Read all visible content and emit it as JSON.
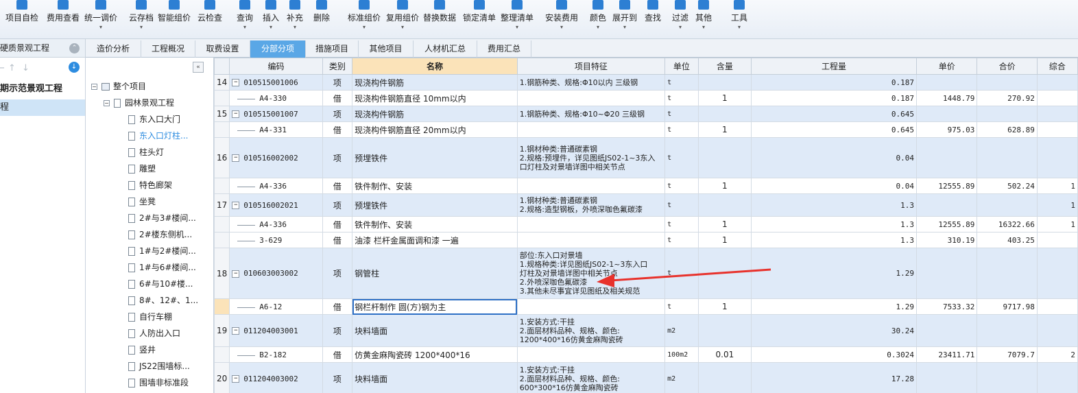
{
  "toolbar": {
    "buttons": [
      {
        "label": "项目自检",
        "icon": "check-icon",
        "dd": false
      },
      {
        "label": "费用查看",
        "icon": "view-icon",
        "dd": false
      },
      {
        "label": "统一调价",
        "icon": "adjust-icon",
        "dd": true
      },
      {
        "label": "云存档",
        "icon": "cloud-upload-icon",
        "dd": true
      },
      {
        "label": "智能组价",
        "icon": "smart-icon",
        "dd": false
      },
      {
        "label": "云检查",
        "icon": "cloud-check-icon",
        "dd": false
      },
      {
        "label": "查询",
        "icon": "search-icon",
        "dd": true
      },
      {
        "label": "插入",
        "icon": "insert-icon",
        "dd": true
      },
      {
        "label": "补充",
        "icon": "add-icon",
        "dd": true
      },
      {
        "label": "删除",
        "icon": "delete-icon",
        "dd": false
      },
      {
        "label": "标准组价",
        "icon": "standard-icon",
        "dd": true
      },
      {
        "label": "复用组价",
        "icon": "reuse-icon",
        "dd": true
      },
      {
        "label": "替换数据",
        "icon": "replace-icon",
        "dd": false
      },
      {
        "label": "锁定清单",
        "icon": "lock-icon",
        "dd": false
      },
      {
        "label": "整理清单",
        "icon": "organize-icon",
        "dd": true
      },
      {
        "label": "安装费用",
        "icon": "install-icon",
        "dd": true
      },
      {
        "label": "颜色",
        "icon": "color-icon",
        "dd": true
      },
      {
        "label": "展开到",
        "icon": "expand-icon",
        "dd": true
      },
      {
        "label": "查找",
        "icon": "find-icon",
        "dd": false
      },
      {
        "label": "过滤",
        "icon": "filter-icon",
        "dd": true
      },
      {
        "label": "其他",
        "icon": "other-icon",
        "dd": true
      },
      {
        "label": "工具",
        "icon": "tool-icon",
        "dd": true
      }
    ]
  },
  "left": {
    "header": "硬质景观工程",
    "project": "期示范景观工程",
    "selected": "程"
  },
  "tabs": [
    "造价分析",
    "工程概况",
    "取费设置",
    "分部分项",
    "措施项目",
    "其他项目",
    "人材机汇总",
    "费用汇总"
  ],
  "active_tab": "分部分项",
  "tree": {
    "root": "整个项目",
    "group": "园林景观工程",
    "items": [
      "东入口大门",
      "东入口灯柱...",
      "柱头灯",
      "雕塑",
      "特色廊架",
      "坐凳",
      "2#与3#楼间...",
      "2#楼东侧机...",
      "1#与2#楼间...",
      "1#与6#楼间...",
      "6#与10#楼...",
      "8#、12#、1...",
      "自行车棚",
      "人防出入口",
      "竖井",
      "JS22围墙标...",
      "围墙非标准段"
    ],
    "highlighted": "东入口灯柱..."
  },
  "grid": {
    "headers": [
      "",
      "编码",
      "类别",
      "名称",
      "项目特征",
      "单位",
      "含量",
      "工程量",
      "单价",
      "合价",
      "综合"
    ],
    "rows": [
      {
        "n": "14",
        "kind": "main",
        "code": "010515001006",
        "cat": "项",
        "name": "现浇构件钢筋",
        "feat": [
          "1.钢筋种类、规格:Φ10以内 三级钢"
        ],
        "unit": "t",
        "qty": "",
        "amt": "0.187",
        "price": "",
        "total": "",
        "last": "",
        "h": 23
      },
      {
        "n": "",
        "kind": "sub",
        "code": "A4-330",
        "cat": "借",
        "name": "现浇构件钢筋直径 10mm以内",
        "feat": [],
        "unit": "t",
        "qty": "1",
        "amt": "0.187",
        "price": "1448.79",
        "total": "270.92",
        "last": "",
        "h": 23
      },
      {
        "n": "15",
        "kind": "main",
        "code": "010515001007",
        "cat": "项",
        "name": "现浇构件钢筋",
        "feat": [
          "1.钢筋种类、规格:Φ10~Φ20 三级钢"
        ],
        "unit": "t",
        "qty": "",
        "amt": "0.645",
        "price": "",
        "total": "",
        "last": "",
        "h": 23
      },
      {
        "n": "",
        "kind": "sub",
        "code": "A4-331",
        "cat": "借",
        "name": "现浇构件钢筋直径 20mm以内",
        "feat": [],
        "unit": "t",
        "qty": "1",
        "amt": "0.645",
        "price": "975.03",
        "total": "628.89",
        "last": "",
        "h": 23
      },
      {
        "n": "16",
        "kind": "main",
        "code": "010516002002",
        "cat": "项",
        "name": "预埋铁件",
        "feat": [
          "1.钢材种类:普通碳素钢",
          "2.规格:预埋件，详见图纸JS02-1~3东入",
          "口灯柱及对景墙详图中相关节点"
        ],
        "unit": "t",
        "qty": "",
        "amt": "0.04",
        "price": "",
        "total": "",
        "last": "",
        "h": 59
      },
      {
        "n": "",
        "kind": "sub",
        "code": "A4-336",
        "cat": "借",
        "name": "铁件制作、安装",
        "feat": [],
        "unit": "t",
        "qty": "1",
        "amt": "0.04",
        "price": "12555.89",
        "total": "502.24",
        "last": "1",
        "h": 23
      },
      {
        "n": "17",
        "kind": "main",
        "code": "010516002021",
        "cat": "项",
        "name": "预埋铁件",
        "feat": [
          "1.钢材种类:普通碳素钢",
          "2.规格:造型钢板，外喷深咖色氟碳漆"
        ],
        "unit": "t",
        "qty": "",
        "amt": "1.3",
        "price": "",
        "total": "",
        "last": "1",
        "h": 33
      },
      {
        "n": "",
        "kind": "sub",
        "code": "A4-336",
        "cat": "借",
        "name": "铁件制作、安装",
        "feat": [],
        "unit": "t",
        "qty": "1",
        "amt": "1.3",
        "price": "12555.89",
        "total": "16322.66",
        "last": "1",
        "h": 23
      },
      {
        "n": "",
        "kind": "sub",
        "code": "3-629",
        "cat": "借",
        "name": "油漆 栏杆金属面调和漆 一遍",
        "feat": [],
        "unit": "t",
        "qty": "1",
        "amt": "1.3",
        "price": "310.19",
        "total": "403.25",
        "last": "",
        "h": 23
      },
      {
        "n": "18",
        "kind": "main",
        "code": "010603003002",
        "cat": "项",
        "name": "钢管柱",
        "feat": [
          "部位:东入口对景墙",
          "1.规格种类:详见图纸JS02-1~3东入口",
          "灯柱及对景墙详图中相关节点",
          "2.外喷深咖色氟碳漆",
          "3.其他未尽事宜详见图纸及相关规范"
        ],
        "unit": "t",
        "qty": "",
        "amt": "1.29",
        "price": "",
        "total": "",
        "last": "",
        "h": 74
      },
      {
        "n": "",
        "kind": "sub",
        "code": "A6-12",
        "cat": "借",
        "name": "钢栏杆制作 圆(方)钢为主",
        "feat": [],
        "unit": "t",
        "qty": "1",
        "amt": "1.29",
        "price": "7533.32",
        "total": "9717.98",
        "last": "",
        "h": 23,
        "current": true
      },
      {
        "n": "19",
        "kind": "main",
        "code": "011204003001",
        "cat": "项",
        "name": "块料墙面",
        "feat": [
          "1.安装方式:干挂",
          "2.面层材料品种、规格、颜色:",
          "1200*400*16仿黄金麻陶瓷砖"
        ],
        "unit": "m2",
        "qty": "",
        "amt": "30.24",
        "price": "",
        "total": "",
        "last": "",
        "h": 47
      },
      {
        "n": "",
        "kind": "sub",
        "code": "B2-182",
        "cat": "借",
        "name": "仿黄金麻陶瓷砖 1200*400*16",
        "feat": [],
        "unit": "100m2",
        "qty": "0.01",
        "amt": "0.3024",
        "price": "23411.71",
        "total": "7079.7",
        "last": "2",
        "h": 23
      },
      {
        "n": "20",
        "kind": "main",
        "code": "011204003002",
        "cat": "项",
        "name": "块料墙面",
        "feat": [
          "1.安装方式:干挂",
          "2.面层材料品种、规格、颜色:",
          "600*300*16仿黄金麻陶瓷砖"
        ],
        "unit": "m2",
        "qty": "",
        "amt": "17.28",
        "price": "",
        "total": "",
        "last": "",
        "h": 47
      }
    ]
  },
  "colors": {
    "accent": "#5aa7e6",
    "main_row": "#dfeaf8",
    "name_header": "#fbe3b9",
    "arrow": "#e8322c"
  }
}
